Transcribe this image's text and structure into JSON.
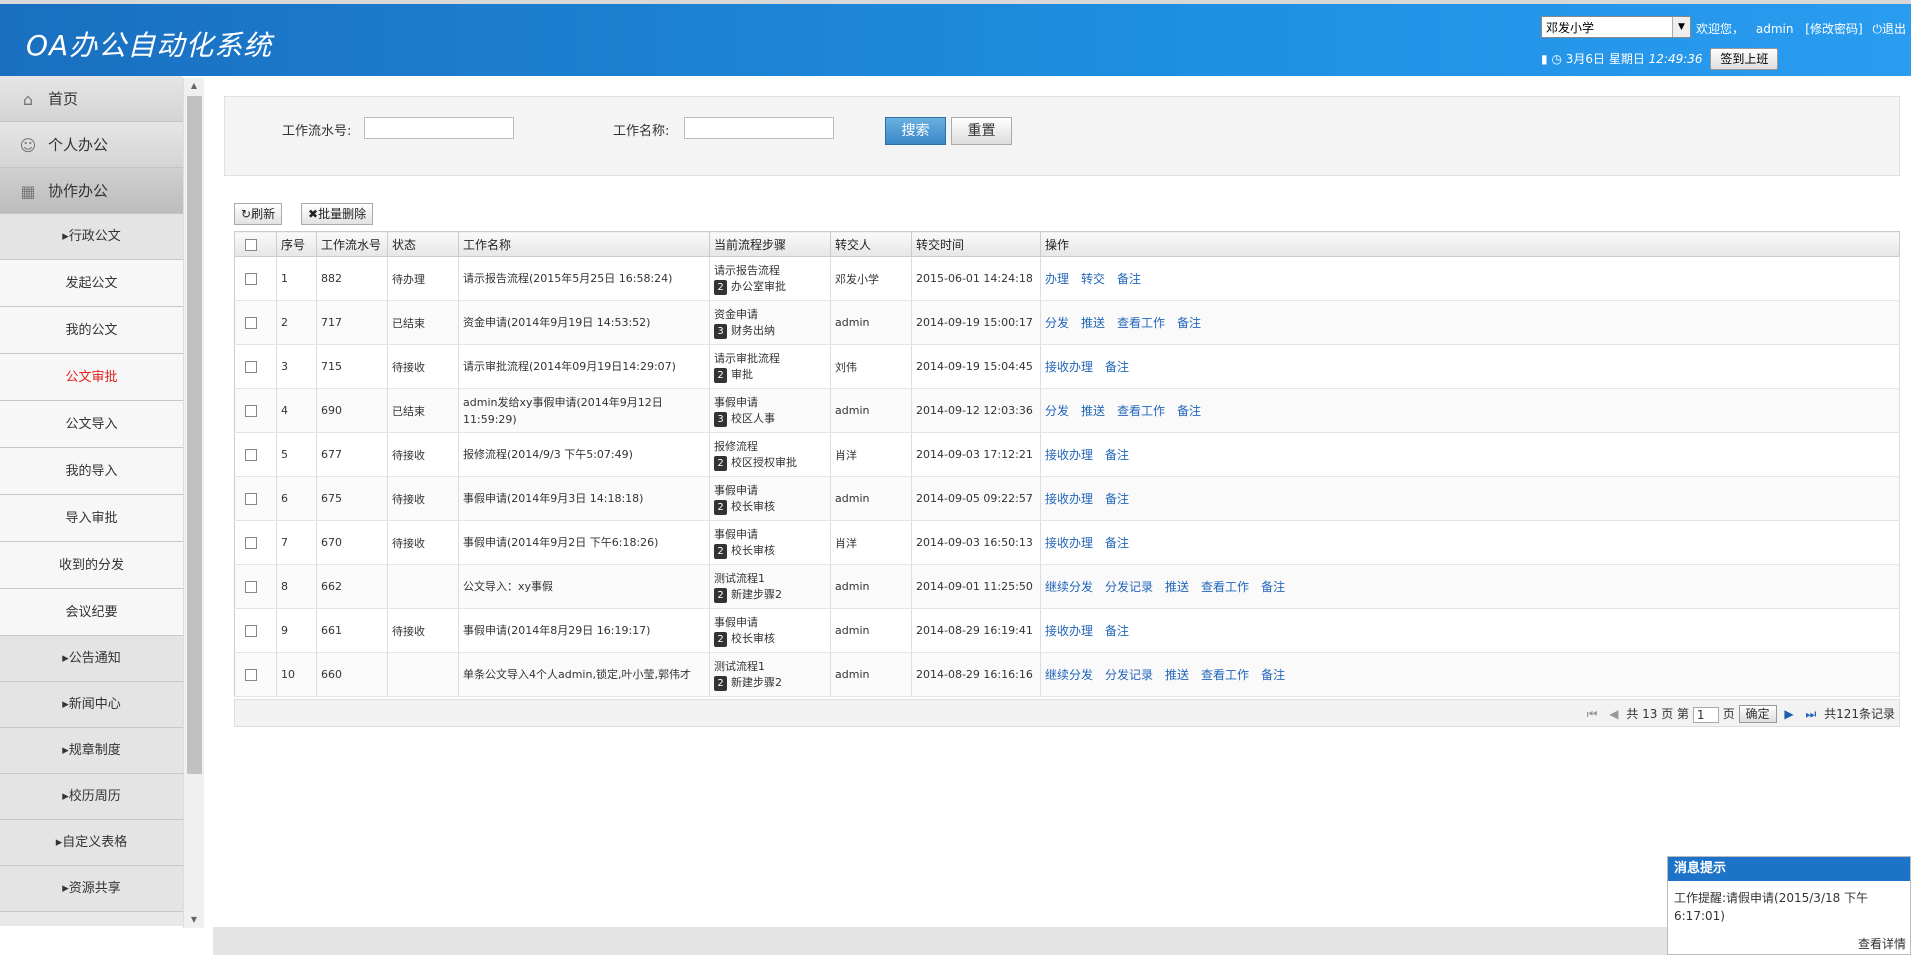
{
  "header": {
    "app_title": "OA办公自动化系统",
    "school": "邓发小学",
    "welcome": "欢迎您，",
    "user": "admin",
    "change_password": "[修改密码]",
    "logout": "退出",
    "date": "3月6日 星期日",
    "time": "12:49:36",
    "sign_in": "签到上班"
  },
  "sidebar": {
    "top_items": [
      {
        "label": "首页",
        "icon": "home-icon"
      },
      {
        "label": "个人办公",
        "icon": "user-icon"
      },
      {
        "label": "协作办公",
        "icon": "grid-icon"
      }
    ],
    "groups": [
      {
        "label": "行政公文"
      },
      {
        "label": "公告通知"
      },
      {
        "label": "新闻中心"
      },
      {
        "label": "规章制度"
      },
      {
        "label": "校历周历"
      },
      {
        "label": "自定义表格"
      },
      {
        "label": "资源共享"
      }
    ],
    "sub_items": [
      "发起公文",
      "我的公文",
      "公文审批",
      "公文导入",
      "我的导入",
      "导入审批",
      "收到的分发",
      "会议纪要"
    ]
  },
  "search": {
    "flow_no_label": "工作流水号:",
    "flow_no_value": "",
    "work_name_label": "工作名称:",
    "work_name_value": "",
    "search_button": "搜索",
    "reset_button": "重置"
  },
  "toolbar": {
    "refresh": "刷新",
    "batch_delete": "批量删除"
  },
  "table": {
    "columns": [
      "序号",
      "工作流水号",
      "状态",
      "工作名称",
      "当前流程步骤",
      "转交人",
      "转交时间",
      "操作"
    ],
    "rows": [
      {
        "no": "1",
        "flow": "882",
        "status": "待办理",
        "name": "请示报告流程(2015年5月25日 16:58:24)",
        "step_title": "请示报告流程",
        "step_num": "2",
        "step_name": "办公室审批",
        "from": "邓发小学",
        "time": "2015-06-01 14:24:18",
        "actions": [
          "办理",
          "转交",
          "备注"
        ]
      },
      {
        "no": "2",
        "flow": "717",
        "status": "已结束",
        "name": "资金申请(2014年9月19日 14:53:52)",
        "step_title": "资金申请",
        "step_num": "3",
        "step_name": "财务出纳",
        "from": "admin",
        "time": "2014-09-19 15:00:17",
        "actions": [
          "分发",
          "推送",
          "查看工作",
          "备注"
        ]
      },
      {
        "no": "3",
        "flow": "715",
        "status": "待接收",
        "name": "请示审批流程(2014年09月19日14:29:07)",
        "step_title": "请示审批流程",
        "step_num": "2",
        "step_name": "审批",
        "from": "刘伟",
        "time": "2014-09-19 15:04:45",
        "actions": [
          "接收办理",
          "备注"
        ]
      },
      {
        "no": "4",
        "flow": "690",
        "status": "已结束",
        "name": "admin发给xy事假申请(2014年9月12日 11:59:29)",
        "step_title": "事假申请",
        "step_num": "3",
        "step_name": "校区人事",
        "from": "admin",
        "time": "2014-09-12 12:03:36",
        "actions": [
          "分发",
          "推送",
          "查看工作",
          "备注"
        ]
      },
      {
        "no": "5",
        "flow": "677",
        "status": "待接收",
        "name": "报修流程(2014/9/3 下午5:07:49)",
        "step_title": "报修流程",
        "step_num": "2",
        "step_name": "校区授权审批",
        "from": "肖洋",
        "time": "2014-09-03 17:12:21",
        "actions": [
          "接收办理",
          "备注"
        ]
      },
      {
        "no": "6",
        "flow": "675",
        "status": "待接收",
        "name": "事假申请(2014年9月3日 14:18:18)",
        "step_title": "事假申请",
        "step_num": "2",
        "step_name": "校长审核",
        "from": "admin",
        "time": "2014-09-05 09:22:57",
        "actions": [
          "接收办理",
          "备注"
        ]
      },
      {
        "no": "7",
        "flow": "670",
        "status": "待接收",
        "name": "事假申请(2014年9月2日 下午6:18:26)",
        "step_title": "事假申请",
        "step_num": "2",
        "step_name": "校长审核",
        "from": "肖洋",
        "time": "2014-09-03 16:50:13",
        "actions": [
          "接收办理",
          "备注"
        ]
      },
      {
        "no": "8",
        "flow": "662",
        "status": "",
        "name": "公文导入：xy事假",
        "step_title": "测试流程1",
        "step_num": "2",
        "step_name": "新建步骤2",
        "from": "admin",
        "time": "2014-09-01 11:25:50",
        "actions": [
          "继续分发",
          "分发记录",
          "推送",
          "查看工作",
          "备注"
        ]
      },
      {
        "no": "9",
        "flow": "661",
        "status": "待接收",
        "name": "事假申请(2014年8月29日 16:19:17)",
        "step_title": "事假申请",
        "step_num": "2",
        "step_name": "校长审核",
        "from": "admin",
        "time": "2014-08-29 16:19:41",
        "actions": [
          "接收办理",
          "备注"
        ]
      },
      {
        "no": "10",
        "flow": "660",
        "status": "",
        "name": "单条公文导入4个人admin,锁定,叶小莹,郭伟才",
        "step_title": "测试流程1",
        "step_num": "2",
        "step_name": "新建步骤2",
        "from": "admin",
        "time": "2014-08-29 16:16:16",
        "actions": [
          "继续分发",
          "分发记录",
          "推送",
          "查看工作",
          "备注"
        ]
      }
    ]
  },
  "pager": {
    "total_pages_prefix": "共",
    "total_pages": "13",
    "pages_suffix": "页 第",
    "current_page": "1",
    "page_suffix": "页",
    "confirm": "确定",
    "total_records": "共121条记录"
  },
  "message": {
    "title": "消息提示",
    "body": "工作提醒:请假申请(2015/3/18 下午6:17:01)",
    "more": "查看详情"
  }
}
